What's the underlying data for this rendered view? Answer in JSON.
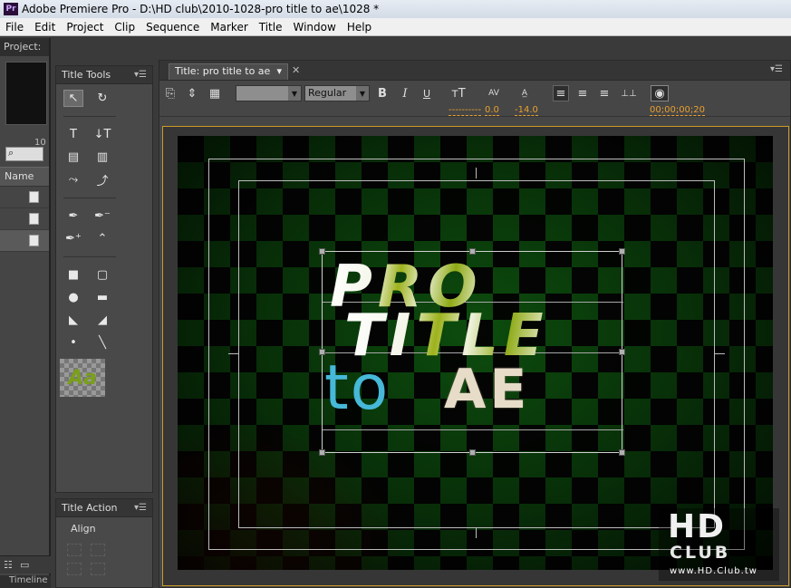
{
  "window": {
    "title": "Adobe Premiere Pro - D:\\HD club\\2010-1028-pro title to ae\\1028 *",
    "app_icon": "Pr"
  },
  "menu": [
    "File",
    "Edit",
    "Project",
    "Clip",
    "Sequence",
    "Marker",
    "Title",
    "Window",
    "Help"
  ],
  "project_panel": {
    "tab": "Project:",
    "count": "10",
    "name_header": "Name",
    "timeline_tab": "Timeline"
  },
  "title_tools": {
    "tab": "Title Tools",
    "style_swatch": "Aa"
  },
  "title_actions": {
    "tab": "Title Action",
    "align_label": "Align"
  },
  "designer": {
    "tab": "Title: pro title to ae",
    "font_style": "Regular",
    "bold": "B",
    "italic": "I",
    "underline": "U",
    "size_value": "----------",
    "kerning_value": "0.0",
    "leading_value": "-14.0",
    "timecode": "00;00;00;20"
  },
  "canvas": {
    "line1": "PRO",
    "line2": "TITLE",
    "line3a": "to",
    "line3b": "AE"
  },
  "watermark": {
    "hd": "HD",
    "club": "CLUB",
    "url": "www.HD.Club.tw"
  }
}
